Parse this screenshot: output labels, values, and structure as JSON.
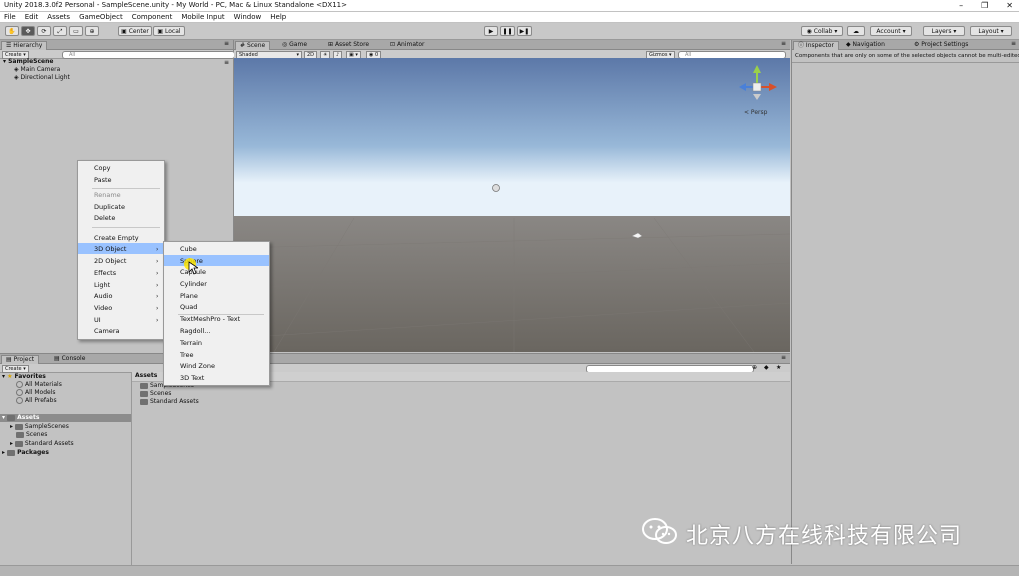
{
  "window": {
    "title": "Unity 2018.3.0f2 Personal - SampleScene.unity - My World - PC, Mac & Linux Standalone <DX11>",
    "minimize": "–",
    "maximize": "❐",
    "close": "✕"
  },
  "menubar": [
    "File",
    "Edit",
    "Assets",
    "GameObject",
    "Component",
    "Mobile Input",
    "Window",
    "Help"
  ],
  "toolbar": {
    "tools": [
      "hand-tool",
      "move-tool",
      "rotate-tool",
      "scale-tool",
      "rect-tool",
      "transform-tool"
    ],
    "pivot": "Center",
    "handle": "Local",
    "collab": "Collab",
    "account": "Account",
    "layers": "Layers",
    "layout": "Layout"
  },
  "hierarchy": {
    "tab": "Hierarchy",
    "create": "Create",
    "search_placeholder": "All",
    "scene": "SampleScene",
    "items": [
      "Main Camera",
      "Directional Light"
    ]
  },
  "scene_view": {
    "tabs": [
      "Scene",
      "Game",
      "Asset Store",
      "Animator"
    ],
    "shading": "Shaded",
    "mode_2d": "2D",
    "gizmos": "Gizmos",
    "search_placeholder": "All",
    "persp": "< Persp"
  },
  "context_menu": {
    "items": [
      {
        "label": "Copy",
        "disabled": false
      },
      {
        "label": "Paste",
        "disabled": false
      },
      {
        "label": "Rename",
        "disabled": true
      },
      {
        "label": "Duplicate",
        "disabled": false
      },
      {
        "label": "Delete",
        "disabled": false
      },
      {
        "label": "Create Empty",
        "disabled": false
      },
      {
        "label": "3D Object",
        "submenu": true
      },
      {
        "label": "2D Object",
        "submenu": true
      },
      {
        "label": "Effects",
        "submenu": true
      },
      {
        "label": "Light",
        "submenu": true
      },
      {
        "label": "Audio",
        "submenu": true
      },
      {
        "label": "Video",
        "submenu": true
      },
      {
        "label": "UI",
        "submenu": true
      },
      {
        "label": "Camera",
        "submenu": false
      }
    ]
  },
  "submenu": {
    "items": [
      "Cube",
      "Sphere",
      "Capsule",
      "Cylinder",
      "Plane",
      "Quad",
      "TextMeshPro - Text",
      "Ragdoll...",
      "Terrain",
      "Tree",
      "Wind Zone",
      "3D Text"
    ],
    "highlighted": "Sphere"
  },
  "inspector": {
    "tabs": [
      "Inspector",
      "Navigation",
      "Project Settings"
    ],
    "message": "Components that are only on some of the selected objects cannot be multi-edited."
  },
  "project": {
    "tabs": [
      "Project",
      "Console"
    ],
    "create": "Create",
    "favorites": "Favorites",
    "favorite_items": [
      "All Materials",
      "All Models",
      "All Prefabs"
    ],
    "assets": "Assets",
    "asset_folders": [
      "SampleScenes",
      "Scenes",
      "Standard Assets"
    ],
    "packages": "Packages",
    "breadcrumb": "Assets",
    "content_items": [
      "SampleScenes",
      "Scenes",
      "Standard Assets"
    ]
  },
  "watermark": "北京八方在线科技有限公司"
}
